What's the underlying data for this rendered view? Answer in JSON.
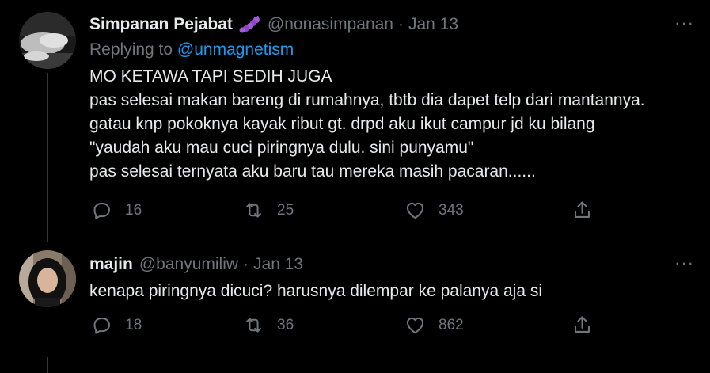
{
  "tweets": [
    {
      "display_name": "Simpanan Pejabat",
      "handle": "@nonasimpanan",
      "separator": "·",
      "date": "Jan 13",
      "replying_prefix": "Replying to",
      "replying_to": "@unmagnetism",
      "lines": [
        "MO KETAWA TAPI SEDIH JUGA",
        "pas selesai makan bareng di rumahnya, tbtb dia dapet telp dari mantannya.",
        "gatau knp pokoknya kayak ribut gt. drpd aku ikut campur jd ku bilang",
        "\"yaudah aku mau cuci piringnya dulu. sini punyamu\"",
        "pas selesai ternyata aku baru tau mereka masih pacaran......"
      ],
      "replies": "16",
      "retweets": "25",
      "likes": "343",
      "name_emoji": "caterpillar-emoji"
    },
    {
      "display_name": "majin",
      "handle": "@banyumiliw",
      "separator": "·",
      "date": "Jan 13",
      "lines": [
        "kenapa piringnya dicuci? harusnya dilempar ke palanya aja si"
      ],
      "replies": "18",
      "retweets": "36",
      "likes": "862"
    }
  ],
  "ui": {
    "more_glyph": "···",
    "icons": [
      "reply-icon",
      "retweet-icon",
      "like-icon",
      "share-icon",
      "more-icon"
    ]
  },
  "colors": {
    "background": "#000000",
    "text": "#e7e9ea",
    "secondary": "#71767b",
    "link": "#1d9bf0",
    "divider": "#2f3336"
  }
}
